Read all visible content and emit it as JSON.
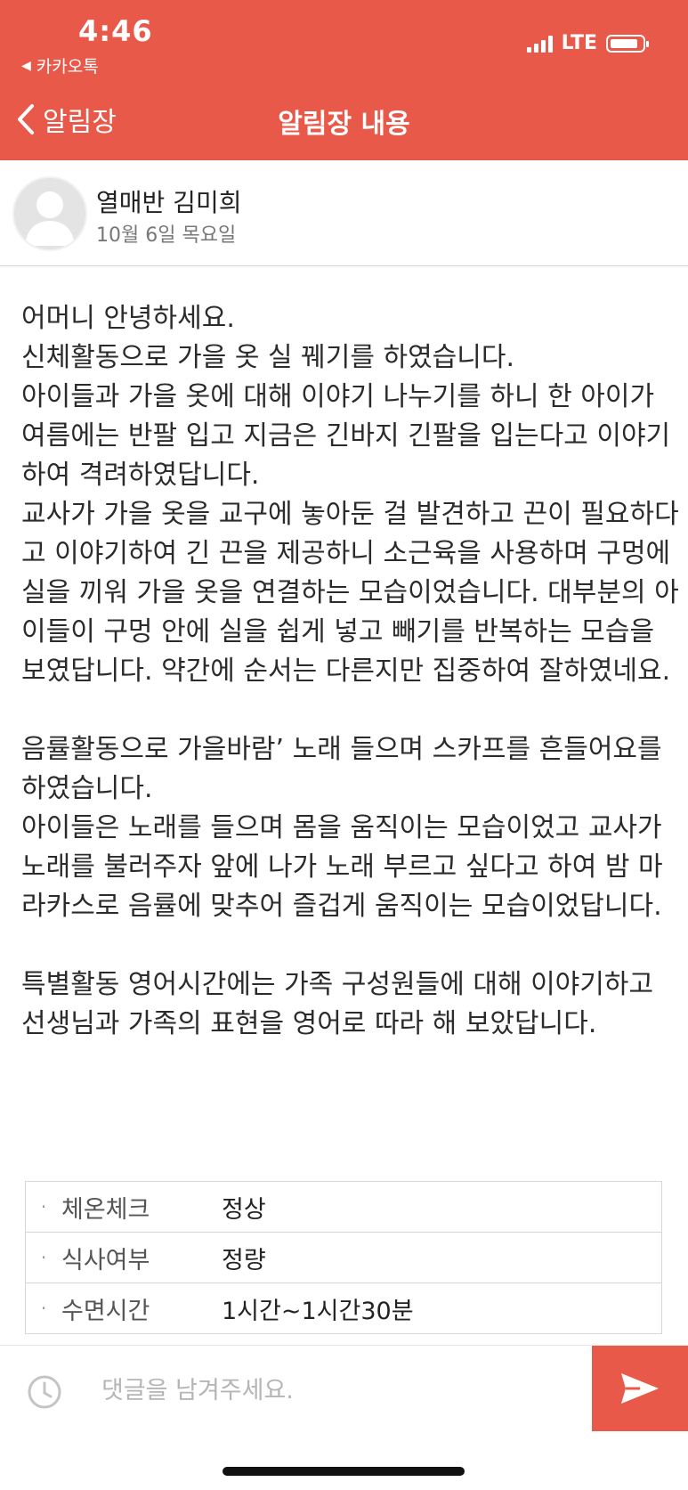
{
  "status_bar": {
    "time": "4:46",
    "back_app": "카카오톡",
    "network": "LTE"
  },
  "nav": {
    "back_label": "알림장",
    "title": "알림장 내용"
  },
  "sender": {
    "name": "열매반 김미희",
    "date": "10월 6일 목요일"
  },
  "body": {
    "p1": "어머니 안녕하세요.",
    "p2": "신체활동으로 가을 옷 실 꿰기를 하였습니다.",
    "p3": "아이들과 가을 옷에 대해 이야기 나누기를 하니 한 아이가 여름에는 반팔 입고 지금은 긴바지 긴팔을 입는다고 이야기하여 격려하였답니다.",
    "p4": "교사가 가을 옷을 교구에 놓아둔 걸 발견하고 끈이 필요하다고 이야기하여 긴 끈을 제공하니 소근육을 사용하며 구멍에 실을 끼워 가을 옷을 연결하는 모습이었습니다. 대부분의 아이들이 구멍 안에 실을 쉽게 넣고 빼기를 반복하는 모습을 보였답니다. 약간에 순서는 다른지만 집중하여 잘하였네요.",
    "p5": "음률활동으로 가을바람’ 노래 들으며 스카프를 흔들어요를 하였습니다.",
    "p6": "아이들은 노래를 들으며 몸을 움직이는 모습이었고 교사가 노래를 불러주자 앞에 나가 노래 부르고 싶다고 하여 밤 마라카스로 음률에 맞추어 즐겁게 움직이는 모습이었답니다.",
    "p7": "특별활동 영어시간에는 가족 구성원들에 대해 이야기하고 선생님과 가족의 표현을 영어로 따라 해 보았답니다."
  },
  "info": [
    {
      "label": "체온체크",
      "value": "정상"
    },
    {
      "label": "식사여부",
      "value": "정량"
    },
    {
      "label": "수면시간",
      "value": "1시간~1시간30분"
    }
  ],
  "comment": {
    "placeholder": "댓글을 남겨주세요."
  },
  "colors": {
    "accent": "#e8594a"
  }
}
